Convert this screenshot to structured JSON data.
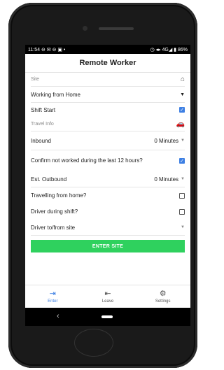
{
  "status_bar": {
    "left": "11:54 ⊖ ✉ ⊖ ▣ •",
    "right": "◷ ◂▸ 4G◢ ▮ 86%"
  },
  "app": {
    "title": "Remote Worker"
  },
  "form": {
    "site_label": "Site",
    "site_icon": "home-icon",
    "working_option": "Working from Home",
    "shift_start_label": "Shift Start",
    "shift_start_checked": true,
    "travel_info_label": "Travel Info",
    "travel_icon": "car-icon",
    "inbound_label": "Inbound",
    "inbound_value": "0 Minutes",
    "confirm_label": "Confirm not worked during the last 12 hours?",
    "confirm_checked": true,
    "est_outbound_label": "Est. Outbound",
    "est_outbound_value": "0 Minutes",
    "travelling_label": "Travelling from home?",
    "travelling_checked": false,
    "driver_shift_label": "Driver during shift?",
    "driver_shift_checked": false,
    "driver_site_label": "Driver to/from site",
    "enter_button": "ENTER SITE"
  },
  "bottom_nav": {
    "items": [
      {
        "label": "Enter",
        "icon": "enter-icon",
        "active": true
      },
      {
        "label": "Leave",
        "icon": "leave-icon",
        "active": false
      },
      {
        "label": "Settings",
        "icon": "gear-icon",
        "active": false
      }
    ]
  },
  "colors": {
    "accent": "#3d7fe3",
    "button": "#2fd15e",
    "phone_body": "#1a1a1a"
  }
}
